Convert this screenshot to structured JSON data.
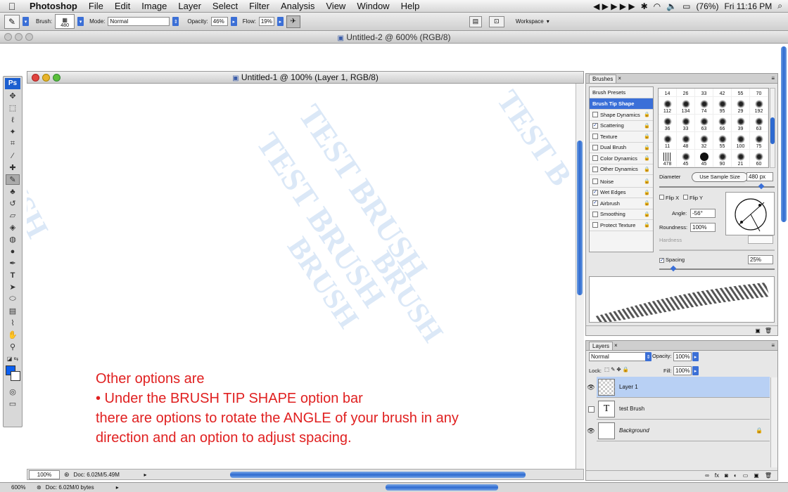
{
  "menubar": {
    "items": [
      "Photoshop",
      "File",
      "Edit",
      "Image",
      "Layer",
      "Select",
      "Filter",
      "Analysis",
      "View",
      "Window",
      "Help"
    ],
    "battery": "(76%)",
    "clock": "Fri 11:16 PM"
  },
  "options": {
    "brush_label": "Brush:",
    "brush_size": "480",
    "mode_label": "Mode:",
    "mode_value": "Normal",
    "opacity_label": "Opacity:",
    "opacity_value": "46%",
    "flow_label": "Flow:",
    "flow_value": "19%",
    "workspace_label": "Workspace"
  },
  "doc2": {
    "title": "Untitled-2 @ 600% (RGB/8)",
    "zoom": "600%",
    "doc_info": "Doc: 6.02M/0 bytes"
  },
  "doc1": {
    "title": "Untitled-1 @ 100% (Layer 1, RGB/8)",
    "zoom": "100%",
    "doc_info": "Doc: 6.02M/5.49M"
  },
  "canvas": {
    "watermark_words": [
      "BRUSH",
      "TEST BRUSH",
      "TEST BRUSH",
      "BRUSH",
      "BRUSH",
      "TEST B"
    ],
    "instructions": [
      "Other options are",
      "• Under the BRUSH TIP SHAPE option bar",
      "there are options to rotate the ANGLE  of your brush in any",
      "direction and an option to adjust spacing."
    ]
  },
  "brushes_panel": {
    "tab": "Brushes",
    "presets": "Brush Presets",
    "tip_shape": "Brush Tip Shape",
    "options": [
      {
        "label": "Shape Dynamics",
        "checked": false
      },
      {
        "label": "Scattering",
        "checked": true
      },
      {
        "label": "Texture",
        "checked": false
      },
      {
        "label": "Dual Brush",
        "checked": false
      },
      {
        "label": "Color Dynamics",
        "checked": false
      },
      {
        "label": "Other Dynamics",
        "checked": false
      },
      {
        "label": "Noise",
        "checked": false
      },
      {
        "label": "Wet Edges",
        "checked": true
      },
      {
        "label": "Airbrush",
        "checked": true
      },
      {
        "label": "Smoothing",
        "checked": false
      },
      {
        "label": "Protect Texture",
        "checked": false
      }
    ],
    "sizes_row1": [
      "14",
      "26",
      "33",
      "42",
      "55",
      "70"
    ],
    "sizes": [
      "112",
      "134",
      "74",
      "95",
      "29",
      "192",
      "36",
      "33",
      "63",
      "66",
      "39",
      "63",
      "11",
      "48",
      "32",
      "55",
      "100",
      "75",
      "478",
      "45",
      "45",
      "90",
      "21",
      "60"
    ],
    "diameter_label": "Diameter",
    "use_sample": "Use Sample Size",
    "diameter_value": "480 px",
    "flip_x": "Flip X",
    "flip_y": "Flip Y",
    "angle_label": "Angle:",
    "angle_value": "-56°",
    "roundness_label": "Roundness:",
    "roundness_value": "100%",
    "hardness_label": "Hardness",
    "spacing_label": "Spacing",
    "spacing_value": "25%"
  },
  "layers_panel": {
    "tab": "Layers",
    "blend": "Normal",
    "opacity_label": "Opacity:",
    "opacity_value": "100%",
    "lock_label": "Lock:",
    "fill_label": "Fill:",
    "fill_value": "100%",
    "layers": [
      {
        "name": "Layer 1"
      },
      {
        "name": "test Brush"
      },
      {
        "name": "Background"
      }
    ]
  }
}
